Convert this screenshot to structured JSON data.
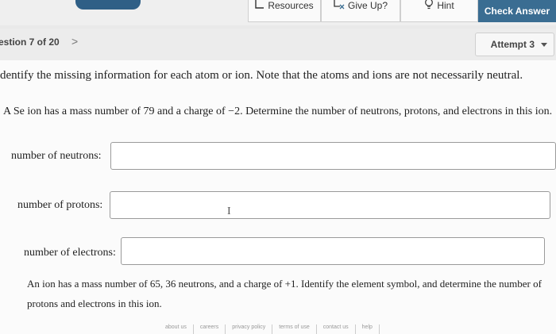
{
  "header": {
    "score_label": "",
    "score_value": "",
    "resources_label": "Resources",
    "giveup_label": "Give Up?",
    "hint_label": "Hint",
    "check_label": "Check Answer"
  },
  "question_nav": {
    "counter": "estion 7 of 20",
    "next_glyph": ">",
    "attempt": "Attempt 3"
  },
  "content": {
    "instruction": "dentify the missing information for each atom or ion. Note that the atoms and ions are not necessarily neutral.",
    "question1": "A Se ion has a mass number of 79 and a charge of −2. Determine the number of neutrons, protons, and electrons in this ion.",
    "fields": {
      "neutrons_label": "number of neutrons:",
      "protons_label": "number of protons:",
      "electrons_label": "number of electrons:"
    },
    "question2": "An ion has a mass number of 65, 36 neutrons, and a charge of +1. Identify the element symbol, and determine the number of protons and electrons in this ion."
  },
  "footer": {
    "links": [
      "about us",
      "careers",
      "privacy policy",
      "terms of use",
      "contact us",
      "help"
    ]
  },
  "colors": {
    "check_button": "#3a6d92",
    "page_bg": "#fbfbfb",
    "bar_bg": "#ececec"
  },
  "icons": [
    "resources-icon",
    "give-up-icon",
    "hint-bulb-icon",
    "chevron-right-icon",
    "caret-down-icon",
    "text-cursor-icon"
  ]
}
